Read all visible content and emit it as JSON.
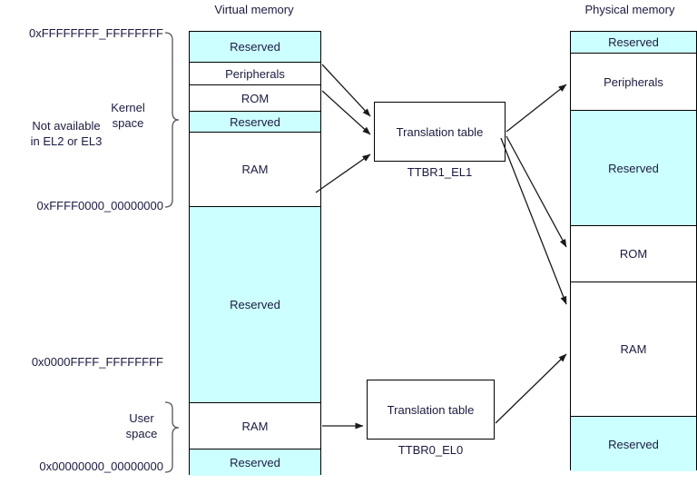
{
  "diagram": {
    "title_virtual": "Virtual memory",
    "title_physical": "Physical memory",
    "virtual_memory": {
      "blocks": [
        {
          "label": "Reserved",
          "fill": "reserved"
        },
        {
          "label": "Peripherals",
          "fill": "plain"
        },
        {
          "label": "ROM",
          "fill": "plain"
        },
        {
          "label": "Reserved",
          "fill": "reserved"
        },
        {
          "label": "RAM",
          "fill": "plain"
        },
        {
          "label": "Reserved",
          "fill": "reserved"
        },
        {
          "label": "RAM",
          "fill": "plain"
        },
        {
          "label": "Reserved",
          "fill": "reserved"
        }
      ],
      "addresses": [
        "0xFFFFFFFF_FFFFFFFF",
        "0xFFFF0000_00000000",
        "0x0000FFFF_FFFFFFFF",
        "0x00000000_00000000"
      ]
    },
    "physical_memory": {
      "blocks": [
        {
          "label": "Reserved",
          "fill": "reserved"
        },
        {
          "label": "Peripherals",
          "fill": "plain"
        },
        {
          "label": "Reserved",
          "fill": "reserved"
        },
        {
          "label": "ROM",
          "fill": "plain"
        },
        {
          "label": "RAM",
          "fill": "plain"
        },
        {
          "label": "Reserved",
          "fill": "reserved"
        }
      ]
    },
    "annotations": {
      "kernel_space": "Kernel\nspace",
      "kernel_space_line1": "Kernel",
      "kernel_space_line2": "space",
      "user_space_line1": "User",
      "user_space_line2": "space",
      "not_available_line1": "Not available",
      "not_available_line2": "in EL2 or EL3"
    },
    "translation_tables": [
      {
        "label": "Translation table",
        "caption": "TTBR1_EL1"
      },
      {
        "label": "Translation table",
        "caption": "TTBR0_EL0"
      }
    ],
    "colors": {
      "reserved_fill": "#ccffff",
      "plain_fill": "#ffffff",
      "stroke": "#000000",
      "text": "#1a1a40"
    }
  }
}
